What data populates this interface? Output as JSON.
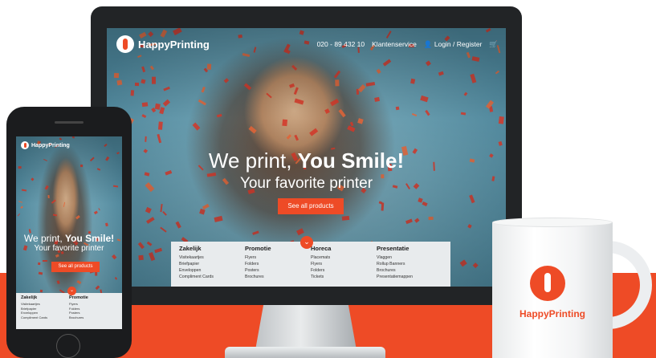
{
  "colors": {
    "accent": "#ee4b26",
    "menu_bg": "#e8ebed",
    "device": "#222426"
  },
  "brand": "HappyPrinting",
  "desktop": {
    "phone_number": "020 - 89 432 10",
    "service_link": "Klantenservice",
    "login_link": "Login / Register",
    "cart_icon": "cart-icon",
    "headline_regular": "We print,",
    "headline_bold": "You Smile!",
    "subheadline": "Your favorite printer",
    "cta": "See all products",
    "menu": [
      {
        "title": "Zakelijk",
        "items": [
          "Visitekaartjes",
          "Briefpapier",
          "Enveloppen",
          "Compliment Cards"
        ]
      },
      {
        "title": "Promotie",
        "items": [
          "Flyers",
          "Folders",
          "Posters",
          "Brochures"
        ]
      },
      {
        "title": "Horeca",
        "items": [
          "Placemats",
          "Flyers",
          "Folders",
          "Tickets"
        ]
      },
      {
        "title": "Presentatie",
        "items": [
          "Vlaggen",
          "Rollup Banners",
          "Brochures",
          "Presentatiemappen"
        ]
      }
    ]
  },
  "mobile": {
    "brand": "HappyPrinting",
    "headline_regular": "We print,",
    "headline_bold": "You Smile!",
    "subheadline": "Your favorite printer",
    "cta": "See all products",
    "menu": [
      {
        "title": "Zakelijk",
        "items": [
          "Visitekaartjes",
          "Briefpapier",
          "Enveloppen",
          "Compliment Cards"
        ]
      },
      {
        "title": "Promotie",
        "items": [
          "Flyers",
          "Folders",
          "Posters",
          "Brochures"
        ]
      }
    ]
  },
  "mug": {
    "brand": "HappyPrinting"
  }
}
